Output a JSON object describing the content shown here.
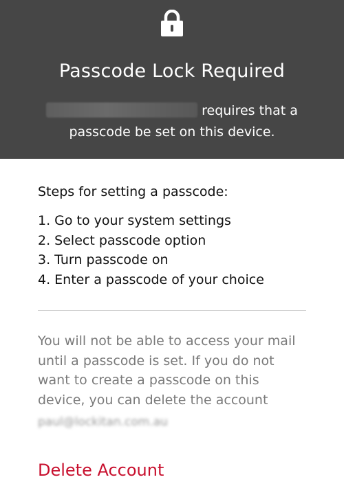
{
  "header": {
    "lock_icon": "lock-icon",
    "title": "Passcode Lock Required",
    "app_name_redacted": "",
    "desc_line1": "requires that a",
    "desc_line2": "passcode be set on this device."
  },
  "steps": {
    "heading": "Steps for setting a passcode:",
    "items": [
      "1. Go to your system settings",
      "2. Select passcode option",
      "3. Turn passcode on",
      "4. Enter a passcode of your choice"
    ]
  },
  "warning": {
    "text": "You will not be able to access your mail until a passcode is set. If you do not want to create a passcode on this device, you can delete the account",
    "email": "paul@lockitan.com.au"
  },
  "actions": {
    "delete_label": "Delete Account"
  },
  "colors": {
    "header_bg": "#464646",
    "accent_red": "#c8102e",
    "muted_text": "#7a7a7a"
  }
}
